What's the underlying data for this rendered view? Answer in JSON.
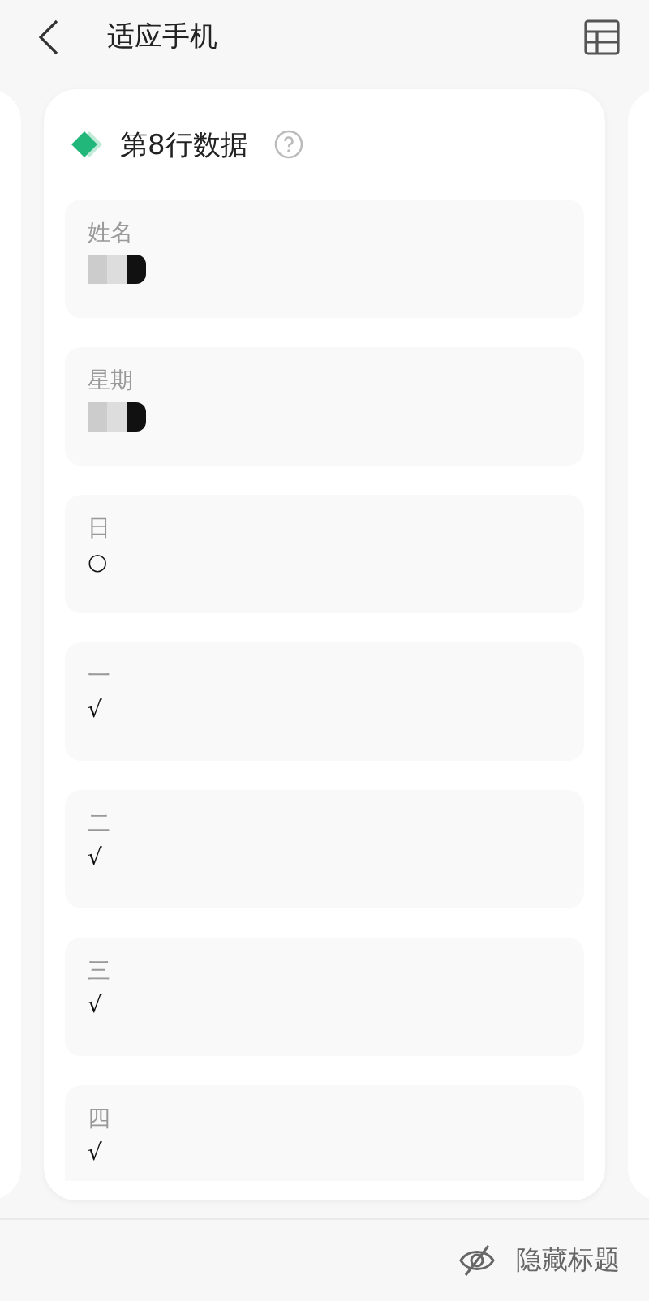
{
  "header": {
    "title": "适应手机"
  },
  "card": {
    "title": "第8行数据"
  },
  "fields": [
    {
      "label": "姓名",
      "kind": "redacted"
    },
    {
      "label": "星期",
      "kind": "redacted"
    },
    {
      "label": "日",
      "kind": "text",
      "value": "○"
    },
    {
      "label": "一",
      "kind": "text",
      "value": "√"
    },
    {
      "label": "二",
      "kind": "text",
      "value": "√"
    },
    {
      "label": "三",
      "kind": "text",
      "value": "√"
    },
    {
      "label": "四",
      "kind": "text",
      "value": "√"
    }
  ],
  "footer": {
    "button": "隐藏标题"
  }
}
